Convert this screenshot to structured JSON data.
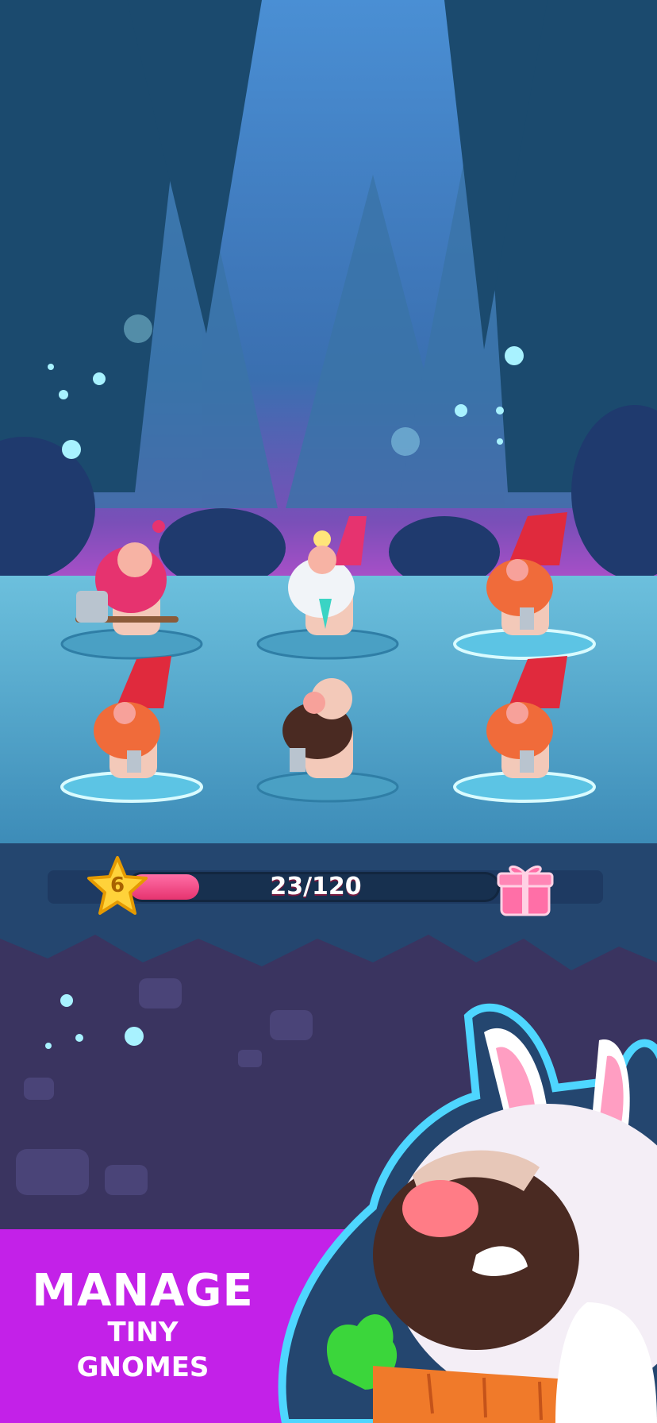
{
  "level": {
    "value": "6"
  },
  "xp": {
    "current": 23,
    "max": 120,
    "label": "23/120",
    "fill_fraction": 0.19
  },
  "gnomes": [
    {
      "hair": "pink",
      "tool": "hammer-icon",
      "hat": "none",
      "selected": false
    },
    {
      "hair": "white",
      "tool": "pickaxe-icon",
      "hat": "helmet-lamp",
      "selected": false
    },
    {
      "hair": "ginger",
      "tool": "hammer-icon",
      "hat": "red",
      "selected": true
    },
    {
      "hair": "ginger",
      "tool": "hammer-icon",
      "hat": "red",
      "selected": true
    },
    {
      "hair": "brown",
      "tool": "hammer-icon",
      "hat": "none",
      "selected": false
    },
    {
      "hair": "ginger",
      "tool": "hammer-icon",
      "hat": "red",
      "selected": true
    }
  ],
  "tagline": {
    "line1": "MANAGE",
    "line2": "TINY",
    "line3": "GNOMES"
  },
  "colors": {
    "banner": "#c321e8",
    "xp_fill": "#e6336f",
    "star": "#ffd23a",
    "sky": "#4a8fd4"
  }
}
